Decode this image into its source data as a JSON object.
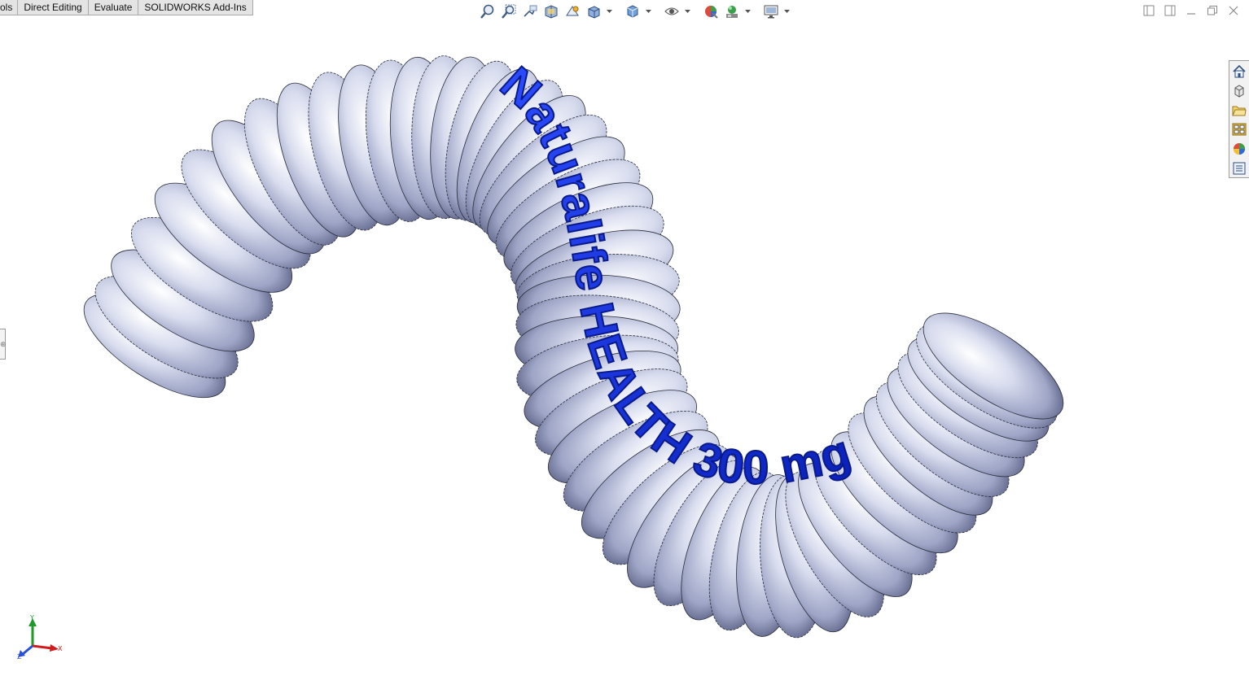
{
  "tabs": [
    {
      "label": "ols"
    },
    {
      "label": "Direct Editing"
    },
    {
      "label": "Evaluate"
    },
    {
      "label": "SOLIDWORKS Add-Ins"
    }
  ],
  "hud_toolbar": {
    "icons": [
      "zoom-to-fit-icon",
      "zoom-to-area-icon",
      "previous-view-icon",
      "section-view-icon",
      "dynamic-annotation-icon",
      "view-orientation-icon",
      "display-style-icon",
      "hide-show-items-icon",
      "edit-appearance-icon",
      "apply-scene-icon",
      "view-settings-icon"
    ]
  },
  "window_controls": [
    "tile-left-icon",
    "tile-right-icon",
    "minimize-icon",
    "restore-icon",
    "close-icon"
  ],
  "task_pane": [
    "solidworks-resources-icon",
    "design-library-icon",
    "file-explorer-icon",
    "view-palette-icon",
    "appearances-icon",
    "custom-properties-icon"
  ],
  "model": {
    "embossed_text": "Naturalife HEALTH 300 mg",
    "body_color": "#c8cde3",
    "text_color": "#1230e0"
  },
  "triad": {
    "y_label": "Y",
    "x_label": "X",
    "z_label": "Z",
    "y_color": "#1f9a2a",
    "x_color": "#d01c1c",
    "z_color": "#2a4fd8"
  }
}
